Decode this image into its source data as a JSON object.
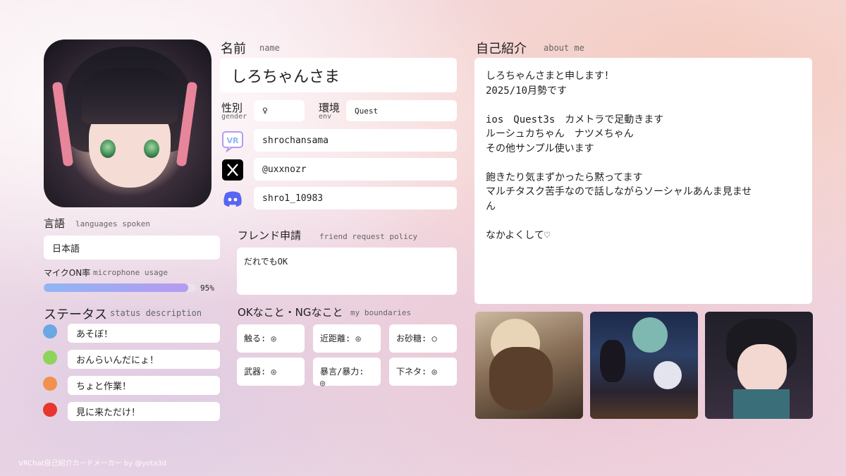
{
  "profile": {
    "name_heading": "名前",
    "name_heading_sub": "name",
    "name": "しろちゃんさま",
    "gender_label": "性別",
    "gender_sub": "gender",
    "gender": "♀",
    "env_label": "環境",
    "env_sub": "env",
    "env": "Quest",
    "vrchat_id": "shrochansama",
    "x_handle": "@uxxnozr",
    "discord": "shro1_10983"
  },
  "languages": {
    "heading": "言語",
    "sub": "languages spoken",
    "value": "日本語"
  },
  "mic": {
    "heading": "マイクON率",
    "sub": "microphone usage",
    "percent_text": "95%",
    "fraction": 0.95
  },
  "status": {
    "heading": "ステータス",
    "sub": "status description",
    "items": [
      {
        "label": "あそぼ！",
        "color": "#6aa7e4"
      },
      {
        "label": "おんらいんだにょ！",
        "color": "#8fd45a"
      },
      {
        "label": "ちょと作業！",
        "color": "#f0924d"
      },
      {
        "label": "見に来ただけ！",
        "color": "#e8352e"
      }
    ]
  },
  "friend": {
    "heading": "フレンド申請",
    "sub": "friend request policy",
    "value": "だれでもOK"
  },
  "boundaries": {
    "heading": "OKなこと・NGなこと",
    "sub": "my boundaries",
    "items": [
      {
        "label": "触る: ◎"
      },
      {
        "label": "近距離: ◎"
      },
      {
        "label": "お砂糖: ○"
      },
      {
        "label": "武器: ◎"
      },
      {
        "label": "暴言/暴力: ◎"
      },
      {
        "label": "下ネタ: ◎"
      }
    ]
  },
  "about": {
    "heading": "自己紹介",
    "sub": "about me",
    "text": "しろちゃんさまと申します！\n2025/10月勢です\n\nios　Quest3s　カメトラで足動きます\nルーシュカちゃん　ナツメちゃん\nその他サンプル使います\n\n飽きたり気まずかったら黙ってます\nマルチタスク苦手なので話しながらソーシャルあんま見ませ\nん\n\nなかよくして♡"
  },
  "footer": {
    "credit": "VRChat自己紹介カードメーカー by @yota3d"
  },
  "icons": {
    "vrchat": "vrchat-icon",
    "x": "x-logo-icon",
    "discord": "discord-icon"
  },
  "colors": {
    "mic_bar_start": "#8fb6f4",
    "mic_bar_end": "#b69af0",
    "discord": "#5865f2"
  }
}
